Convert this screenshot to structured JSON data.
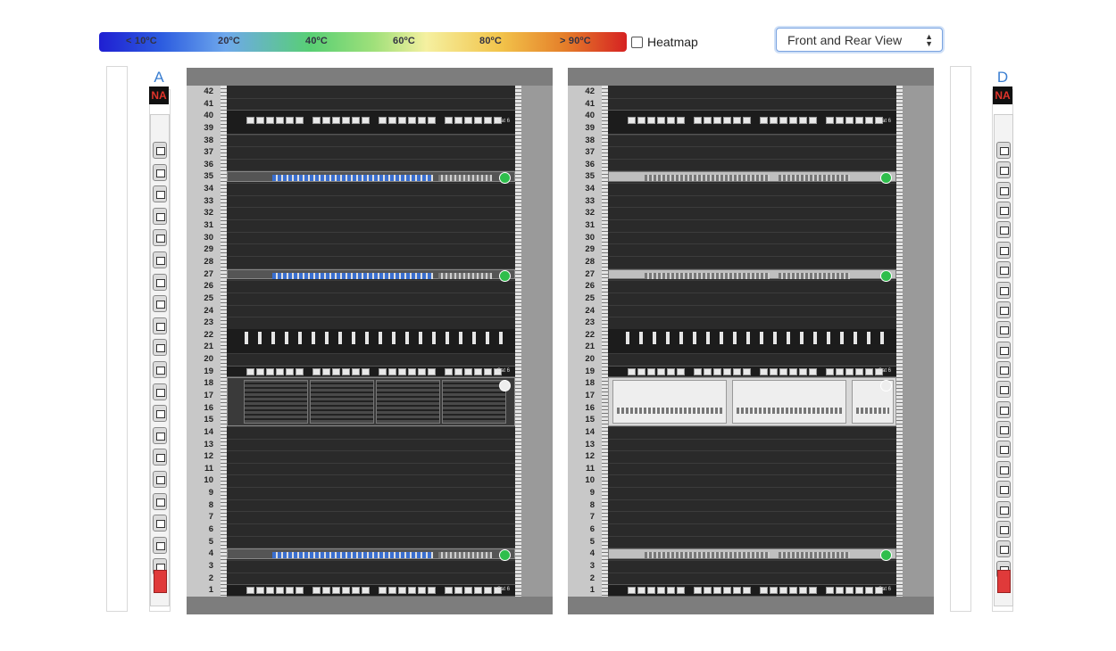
{
  "toolbar": {
    "scale_labels": [
      "< 10ºC",
      "20ºC",
      "40ºC",
      "60ºC",
      "80ºC",
      "> 90ºC"
    ],
    "heatmap_label": "Heatmap",
    "view_select": "Front and Rear View"
  },
  "pdu_left": {
    "label": "A",
    "status": "NA"
  },
  "pdu_right": {
    "label": "D",
    "status": "NA"
  },
  "rack_units": [
    "42",
    "41",
    "40",
    "39",
    "38",
    "37",
    "36",
    "35",
    "34",
    "33",
    "32",
    "31",
    "30",
    "29",
    "28",
    "27",
    "26",
    "25",
    "24",
    "23",
    "22",
    "21",
    "20",
    "19",
    "18",
    "17",
    "16",
    "15",
    "14",
    "13",
    "12",
    "11",
    "10",
    "9",
    "8",
    "7",
    "6",
    "5",
    "4",
    "3",
    "2",
    "1"
  ],
  "devices": [
    {
      "name": "patch-panel",
      "u": 39,
      "height": 2,
      "label": "Cat 6"
    },
    {
      "name": "switch",
      "u": 35,
      "height": 1
    },
    {
      "name": "switch",
      "u": 27,
      "height": 1
    },
    {
      "name": "cable-manager",
      "u": 21,
      "height": 2
    },
    {
      "name": "patch-panel",
      "u": 19,
      "height": 1,
      "label": "Cat 6"
    },
    {
      "name": "storage-server",
      "u": 15,
      "height": 4
    },
    {
      "name": "switch",
      "u": 4,
      "height": 1
    },
    {
      "name": "patch-panel",
      "u": 1,
      "height": 1,
      "label": "Cat 6"
    }
  ],
  "colors": {
    "accent": "#3b7fd1",
    "status_na": "#e0342b",
    "power_on": "#2fbe4c"
  }
}
